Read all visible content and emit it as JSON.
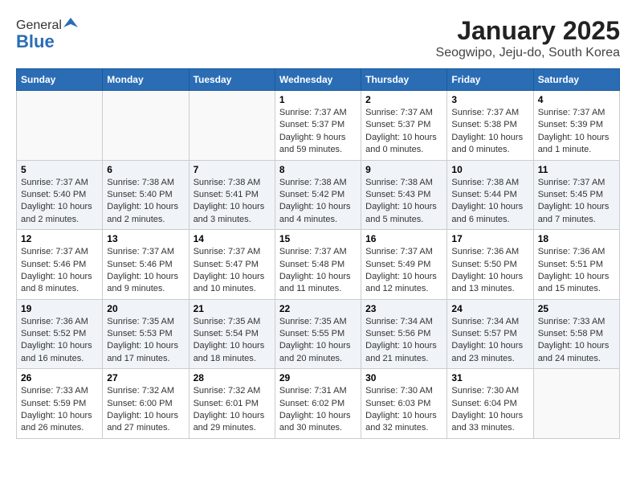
{
  "header": {
    "logo_general": "General",
    "logo_blue": "Blue",
    "title": "January 2025",
    "subtitle": "Seogwipo, Jeju-do, South Korea"
  },
  "days_of_week": [
    "Sunday",
    "Monday",
    "Tuesday",
    "Wednesday",
    "Thursday",
    "Friday",
    "Saturday"
  ],
  "weeks": [
    {
      "shaded": false,
      "days": [
        {
          "num": "",
          "info": ""
        },
        {
          "num": "",
          "info": ""
        },
        {
          "num": "",
          "info": ""
        },
        {
          "num": "1",
          "info": "Sunrise: 7:37 AM\nSunset: 5:37 PM\nDaylight: 9 hours and 59 minutes."
        },
        {
          "num": "2",
          "info": "Sunrise: 7:37 AM\nSunset: 5:37 PM\nDaylight: 10 hours and 0 minutes."
        },
        {
          "num": "3",
          "info": "Sunrise: 7:37 AM\nSunset: 5:38 PM\nDaylight: 10 hours and 0 minutes."
        },
        {
          "num": "4",
          "info": "Sunrise: 7:37 AM\nSunset: 5:39 PM\nDaylight: 10 hours and 1 minute."
        }
      ]
    },
    {
      "shaded": true,
      "days": [
        {
          "num": "5",
          "info": "Sunrise: 7:37 AM\nSunset: 5:40 PM\nDaylight: 10 hours and 2 minutes."
        },
        {
          "num": "6",
          "info": "Sunrise: 7:38 AM\nSunset: 5:40 PM\nDaylight: 10 hours and 2 minutes."
        },
        {
          "num": "7",
          "info": "Sunrise: 7:38 AM\nSunset: 5:41 PM\nDaylight: 10 hours and 3 minutes."
        },
        {
          "num": "8",
          "info": "Sunrise: 7:38 AM\nSunset: 5:42 PM\nDaylight: 10 hours and 4 minutes."
        },
        {
          "num": "9",
          "info": "Sunrise: 7:38 AM\nSunset: 5:43 PM\nDaylight: 10 hours and 5 minutes."
        },
        {
          "num": "10",
          "info": "Sunrise: 7:38 AM\nSunset: 5:44 PM\nDaylight: 10 hours and 6 minutes."
        },
        {
          "num": "11",
          "info": "Sunrise: 7:37 AM\nSunset: 5:45 PM\nDaylight: 10 hours and 7 minutes."
        }
      ]
    },
    {
      "shaded": false,
      "days": [
        {
          "num": "12",
          "info": "Sunrise: 7:37 AM\nSunset: 5:46 PM\nDaylight: 10 hours and 8 minutes."
        },
        {
          "num": "13",
          "info": "Sunrise: 7:37 AM\nSunset: 5:46 PM\nDaylight: 10 hours and 9 minutes."
        },
        {
          "num": "14",
          "info": "Sunrise: 7:37 AM\nSunset: 5:47 PM\nDaylight: 10 hours and 10 minutes."
        },
        {
          "num": "15",
          "info": "Sunrise: 7:37 AM\nSunset: 5:48 PM\nDaylight: 10 hours and 11 minutes."
        },
        {
          "num": "16",
          "info": "Sunrise: 7:37 AM\nSunset: 5:49 PM\nDaylight: 10 hours and 12 minutes."
        },
        {
          "num": "17",
          "info": "Sunrise: 7:36 AM\nSunset: 5:50 PM\nDaylight: 10 hours and 13 minutes."
        },
        {
          "num": "18",
          "info": "Sunrise: 7:36 AM\nSunset: 5:51 PM\nDaylight: 10 hours and 15 minutes."
        }
      ]
    },
    {
      "shaded": true,
      "days": [
        {
          "num": "19",
          "info": "Sunrise: 7:36 AM\nSunset: 5:52 PM\nDaylight: 10 hours and 16 minutes."
        },
        {
          "num": "20",
          "info": "Sunrise: 7:35 AM\nSunset: 5:53 PM\nDaylight: 10 hours and 17 minutes."
        },
        {
          "num": "21",
          "info": "Sunrise: 7:35 AM\nSunset: 5:54 PM\nDaylight: 10 hours and 18 minutes."
        },
        {
          "num": "22",
          "info": "Sunrise: 7:35 AM\nSunset: 5:55 PM\nDaylight: 10 hours and 20 minutes."
        },
        {
          "num": "23",
          "info": "Sunrise: 7:34 AM\nSunset: 5:56 PM\nDaylight: 10 hours and 21 minutes."
        },
        {
          "num": "24",
          "info": "Sunrise: 7:34 AM\nSunset: 5:57 PM\nDaylight: 10 hours and 23 minutes."
        },
        {
          "num": "25",
          "info": "Sunrise: 7:33 AM\nSunset: 5:58 PM\nDaylight: 10 hours and 24 minutes."
        }
      ]
    },
    {
      "shaded": false,
      "days": [
        {
          "num": "26",
          "info": "Sunrise: 7:33 AM\nSunset: 5:59 PM\nDaylight: 10 hours and 26 minutes."
        },
        {
          "num": "27",
          "info": "Sunrise: 7:32 AM\nSunset: 6:00 PM\nDaylight: 10 hours and 27 minutes."
        },
        {
          "num": "28",
          "info": "Sunrise: 7:32 AM\nSunset: 6:01 PM\nDaylight: 10 hours and 29 minutes."
        },
        {
          "num": "29",
          "info": "Sunrise: 7:31 AM\nSunset: 6:02 PM\nDaylight: 10 hours and 30 minutes."
        },
        {
          "num": "30",
          "info": "Sunrise: 7:30 AM\nSunset: 6:03 PM\nDaylight: 10 hours and 32 minutes."
        },
        {
          "num": "31",
          "info": "Sunrise: 7:30 AM\nSunset: 6:04 PM\nDaylight: 10 hours and 33 minutes."
        },
        {
          "num": "",
          "info": ""
        }
      ]
    }
  ]
}
